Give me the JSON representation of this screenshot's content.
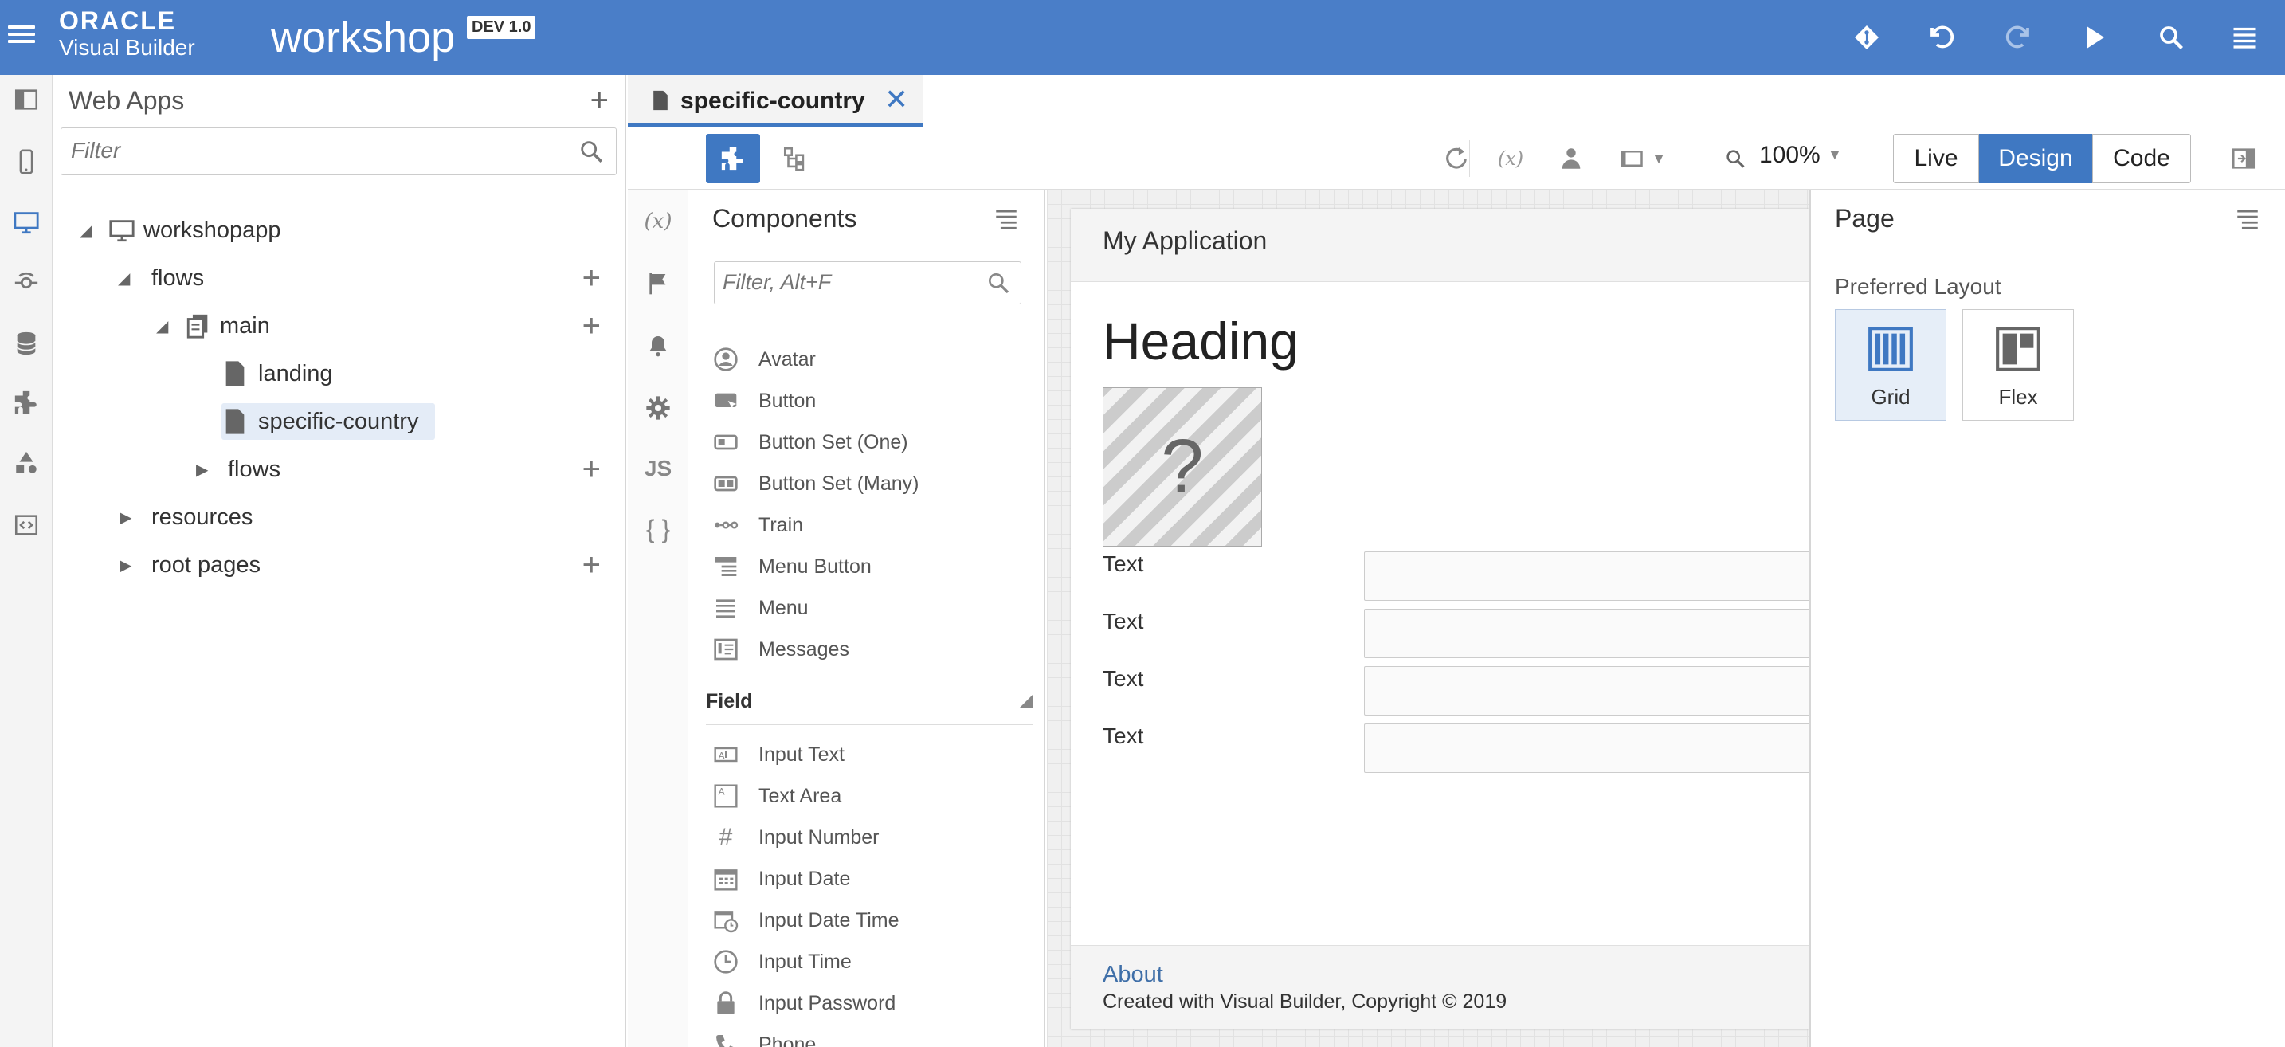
{
  "header": {
    "brand_line1": "ORACLE",
    "brand_line2": "Visual Builder",
    "app_name": "workshop",
    "badge": "DEV 1.0",
    "icons": [
      "git-icon",
      "undo-icon",
      "redo-icon",
      "run-icon",
      "search-icon",
      "menu-icon"
    ],
    "bg_color": "#4a7ec8"
  },
  "rail": {
    "icons": [
      "collapse-panel-icon",
      "mobile-apps-icon",
      "web-apps-icon",
      "services-icon",
      "business-objects-icon",
      "components-icon",
      "processes-icon",
      "source-icon"
    ]
  },
  "navigator": {
    "title": "Web Apps",
    "filter_placeholder": "Filter",
    "tree": [
      {
        "label": "workshopapp"
      },
      {
        "label": "flows"
      },
      {
        "label": "main"
      },
      {
        "label": "landing"
      },
      {
        "label": "specific-country",
        "selected": true
      },
      {
        "label": "flows"
      },
      {
        "label": "resources"
      },
      {
        "label": "root pages"
      }
    ]
  },
  "tabs": [
    {
      "label": "specific-country",
      "active": true
    }
  ],
  "toolbar": {
    "zoom": "100%",
    "modes": [
      "Live",
      "Design",
      "Code"
    ],
    "active_mode": "Design",
    "accent": "#3f78c2"
  },
  "components": {
    "title": "Components",
    "filter_placeholder": "Filter, Alt+F",
    "items": [
      {
        "label": "Avatar",
        "icon": "avatar-icon"
      },
      {
        "label": "Button",
        "icon": "button-icon"
      },
      {
        "label": "Button Set (One)",
        "icon": "button-set-one-icon"
      },
      {
        "label": "Button Set (Many)",
        "icon": "button-set-many-icon"
      },
      {
        "label": "Train",
        "icon": "train-icon"
      },
      {
        "label": "Menu Button",
        "icon": "menu-button-icon"
      },
      {
        "label": "Menu",
        "icon": "menu-icon"
      },
      {
        "label": "Messages",
        "icon": "messages-icon"
      }
    ],
    "section": "Field",
    "field_items": [
      {
        "label": "Input Text",
        "icon": "input-text-icon"
      },
      {
        "label": "Text Area",
        "icon": "text-area-icon"
      },
      {
        "label": "Input Number",
        "icon": "hash-icon"
      },
      {
        "label": "Input Date",
        "icon": "calendar-icon"
      },
      {
        "label": "Input Date Time",
        "icon": "calendar-clock-icon"
      },
      {
        "label": "Input Time",
        "icon": "clock-icon"
      },
      {
        "label": "Input Password",
        "icon": "lock-icon"
      },
      {
        "label": "Phone",
        "icon": "phone-icon"
      }
    ]
  },
  "canvas": {
    "app_title": "My Application",
    "heading": "Heading",
    "image_placeholder": "?",
    "form_labels": [
      "Text",
      "Text",
      "Text",
      "Text"
    ],
    "footer_link": "About",
    "footer_text": "Created with Visual Builder, Copyright © 2019"
  },
  "properties": {
    "title": "Page",
    "subtitle": "Preferred Layout",
    "layouts": [
      {
        "label": "Grid",
        "active": true
      },
      {
        "label": "Flex",
        "active": false
      }
    ]
  }
}
